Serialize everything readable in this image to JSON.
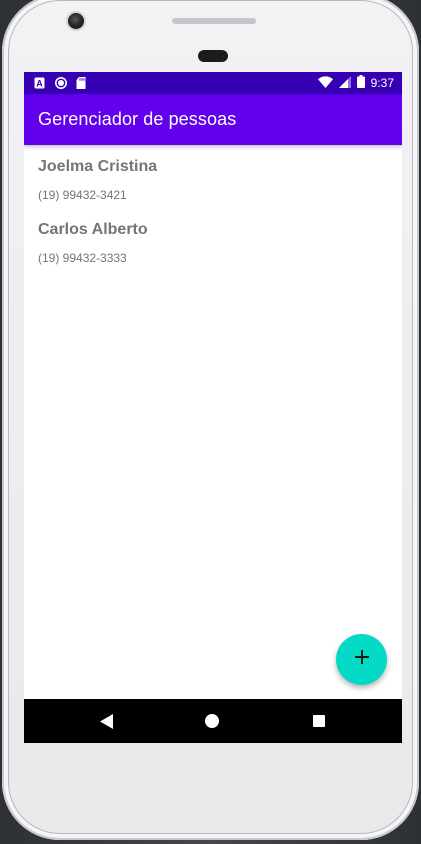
{
  "status_bar": {
    "time": "9:37",
    "left_icons": [
      "a-notification-icon",
      "circle-notification-icon",
      "sd-card-icon"
    ],
    "right_icons": [
      "wifi-icon",
      "signal-icon",
      "battery-icon"
    ],
    "color": "#3700b3"
  },
  "app_bar": {
    "title": "Gerenciador de pessoas",
    "color": "#6200ee"
  },
  "people": [
    {
      "name": "Joelma Cristina",
      "phone": "(19) 99432-3421"
    },
    {
      "name": "Carlos Alberto",
      "phone": "(19) 99432-3333"
    }
  ],
  "fab": {
    "icon": "plus-icon",
    "color": "#03dac5"
  },
  "nav_bar": {
    "icons": [
      "back-icon",
      "home-icon",
      "recents-icon"
    ]
  }
}
